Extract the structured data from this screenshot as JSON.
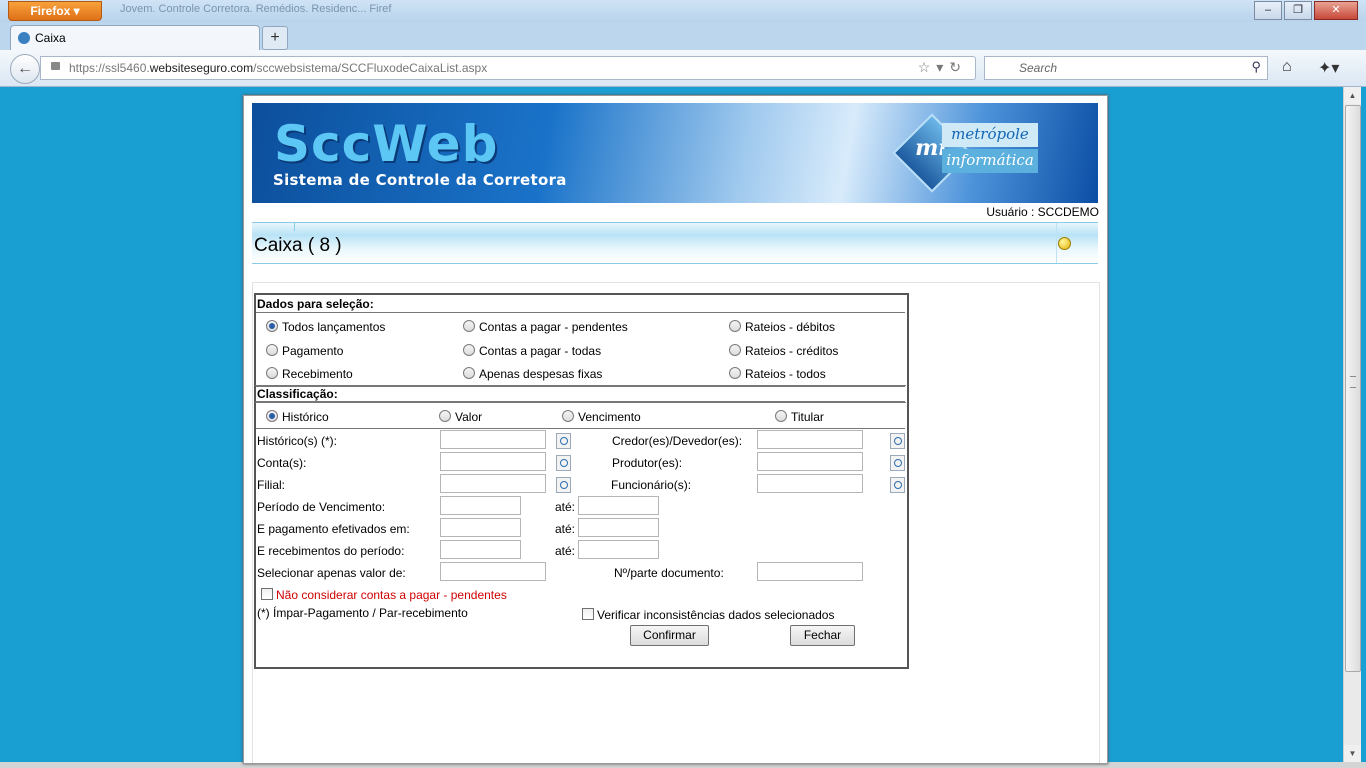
{
  "browser": {
    "menu_button": "Firefox",
    "window_title": "Jovem. Controle Corretora. Remédios. Residenc... Firef",
    "tab_title": "Caixa",
    "url_prefix": "https://ssl5460.",
    "url_domain": "websiteseguro.com",
    "url_path": "/sccwebsistema/SCCFluxodeCaixaList.aspx",
    "search_placeholder": "Search",
    "minimize": "‒",
    "maximize": "❐",
    "close": "✕"
  },
  "header": {
    "logo_title": "SccWeb",
    "logo_subtitle": "Sistema de Controle da Corretora",
    "partner_initials": "mi",
    "partner_name_1": "metrópole",
    "partner_name_2": "informática",
    "user_label": "Usuário : SCCDEMO"
  },
  "page_title": "Caixa ( 8 )",
  "selection": {
    "heading": "Dados para seleção:",
    "options": [
      {
        "label": "Todos lançamentos",
        "selected": true
      },
      {
        "label": "Contas a pagar - pendentes",
        "selected": false
      },
      {
        "label": "Rateios - débitos",
        "selected": false
      },
      {
        "label": "Pagamento",
        "selected": false
      },
      {
        "label": "Contas a pagar - todas",
        "selected": false
      },
      {
        "label": "Rateios - créditos",
        "selected": false
      },
      {
        "label": "Recebimento",
        "selected": false
      },
      {
        "label": "Apenas despesas fixas",
        "selected": false
      },
      {
        "label": "Rateios - todos",
        "selected": false
      }
    ]
  },
  "classification": {
    "heading": "Classificação:",
    "options": [
      {
        "label": "Histórico",
        "selected": true
      },
      {
        "label": "Valor",
        "selected": false
      },
      {
        "label": "Vencimento",
        "selected": false
      },
      {
        "label": "Titular",
        "selected": false
      }
    ]
  },
  "fields": {
    "historico": {
      "label": "Histórico(s) (*):",
      "value": ""
    },
    "credor": {
      "label": "Credor(es)/Devedor(es):",
      "value": ""
    },
    "conta": {
      "label": "Conta(s):",
      "value": ""
    },
    "produtor": {
      "label": "Produtor(es):",
      "value": ""
    },
    "filial": {
      "label": "Filial:",
      "value": ""
    },
    "funcionario": {
      "label": "Funcionário(s):",
      "value": ""
    },
    "periodo_vencimento": {
      "label": "Período de Vencimento:",
      "ate": "até:"
    },
    "pagamentos": {
      "label": "E pagamento efetivados em:",
      "ate": "até:"
    },
    "recebimentos": {
      "label": "E recebimentos do período:",
      "ate": "até:"
    },
    "valor": {
      "label": "Selecionar apenas valor de:",
      "value": ""
    },
    "documento": {
      "label": "Nº/parte documento:",
      "value": ""
    }
  },
  "checkboxes": {
    "nao_considerar": {
      "label": "Não considerar contas a pagar - pendentes",
      "checked": false,
      "color": "#d00000"
    },
    "verificar": {
      "label": "Verificar inconsistências dados selecionados",
      "checked": false
    }
  },
  "note": "(*) Ímpar-Pagamento / Par-recebimento",
  "buttons": {
    "confirm": "Confirmar",
    "close": "Fechar"
  },
  "colors": {
    "desktop_bg": "#1a9fd3",
    "banner_blue": "#0c4f9c",
    "accent_red": "#d00000"
  }
}
